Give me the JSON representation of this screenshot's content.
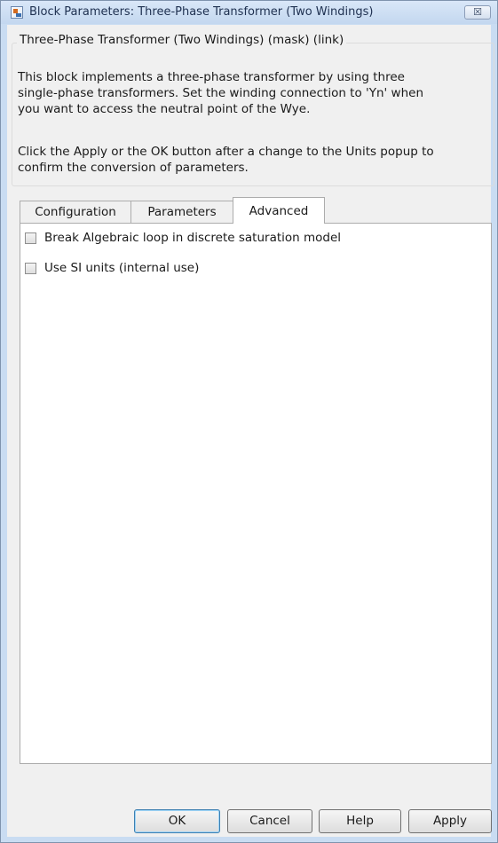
{
  "window": {
    "title": "Block Parameters: Three-Phase Transformer (Two Windings)",
    "close_glyph": "☒"
  },
  "mask": {
    "group_title": "Three-Phase Transformer (Two Windings) (mask) (link)",
    "description_lines": [
      "This block implements a three-phase transformer by using three",
      "single-phase transformers. Set the winding connection to 'Yn'  when",
      "you want to access the neutral point of the Wye.",
      "",
      "Click the Apply or the OK button after a change to the Units popup to",
      "confirm the conversion of parameters."
    ]
  },
  "tabs": [
    {
      "label": "Configuration",
      "active": false
    },
    {
      "label": "Parameters",
      "active": false
    },
    {
      "label": "Advanced",
      "active": true
    }
  ],
  "advanced": {
    "checkboxes": [
      {
        "label": "Break Algebraic loop in discrete saturation model",
        "checked": false
      },
      {
        "label": "Use SI units (internal use)",
        "checked": false
      }
    ]
  },
  "buttons": {
    "ok": "OK",
    "cancel": "Cancel",
    "help": "Help",
    "apply": "Apply"
  },
  "icons": {
    "window_icon": "block-parameters-icon",
    "close": "close-icon"
  }
}
